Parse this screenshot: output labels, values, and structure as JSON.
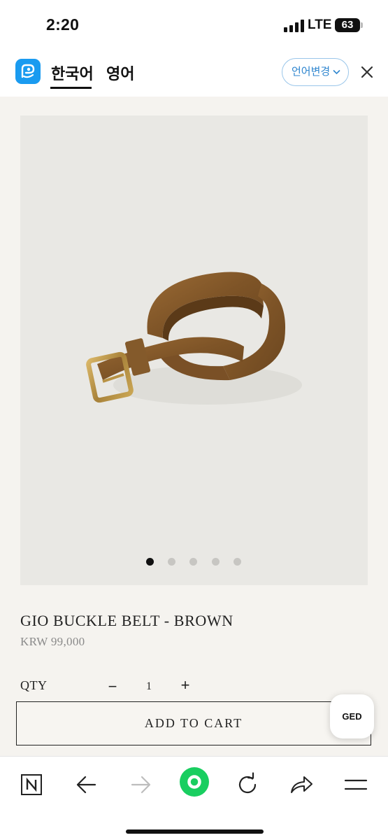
{
  "status_bar": {
    "time": "2:20",
    "network": "LTE",
    "battery": "63"
  },
  "translate_bar": {
    "language_tabs": [
      {
        "label": "한국어",
        "selected": true
      },
      {
        "label": "영어",
        "selected": false
      }
    ],
    "change_language_label": "언어변경",
    "accent_color": "#1a9bf0",
    "icons": {
      "logo": "papago-icon",
      "close": "close-icon",
      "dropdown": "chevron-down-icon"
    }
  },
  "product": {
    "title": "GIO BUCKLE BELT - BROWN",
    "price": "KRW 99,000",
    "image_count": 5,
    "active_image_index": 0,
    "qty_label": "QTY",
    "qty_minus": "−",
    "qty_value": "1",
    "qty_plus": "+",
    "add_to_cart_label": "ADD TO CART",
    "floating_badge": "GED"
  },
  "browser_toolbar": {
    "buttons": [
      "naver-home-icon",
      "back-arrow-icon",
      "forward-arrow-icon",
      "green-dot-icon",
      "reload-icon",
      "share-icon",
      "menu-icon"
    ]
  }
}
